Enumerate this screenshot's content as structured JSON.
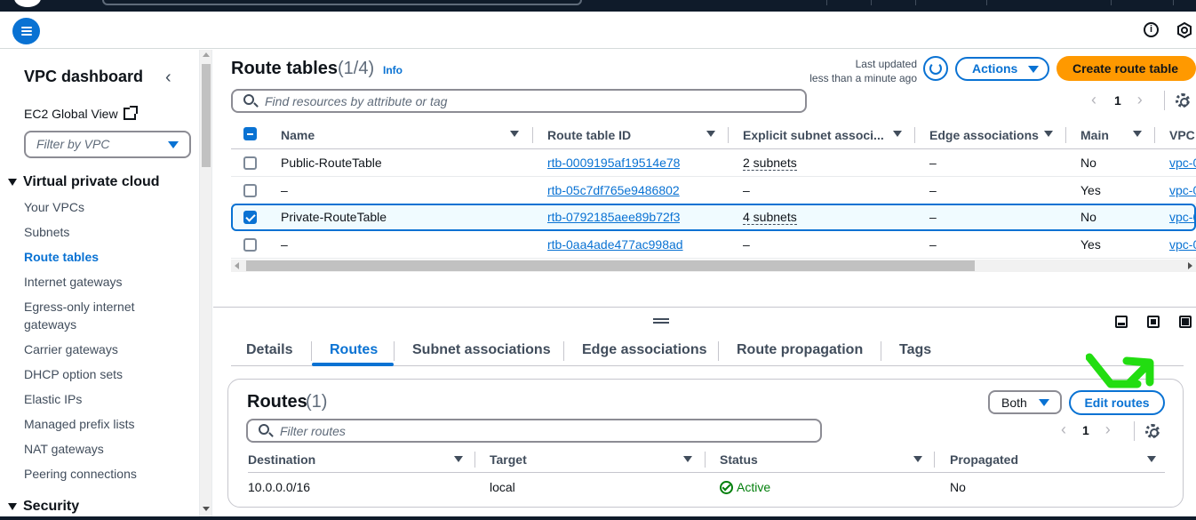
{
  "colors": {
    "accent": "#0972d3",
    "primary_button": "#ff9900",
    "success": "#037f0c",
    "annotation_arrow": "#22dd11"
  },
  "sidebar": {
    "title": "VPC dashboard",
    "ec2_global_view": "EC2 Global View",
    "filter_placeholder": "Filter by VPC",
    "sections": [
      {
        "label": "Virtual private cloud",
        "items": [
          "Your VPCs",
          "Subnets",
          "Route tables",
          "Internet gateways",
          "Egress-only internet gateways",
          "Carrier gateways",
          "DHCP option sets",
          "Elastic IPs",
          "Managed prefix lists",
          "NAT gateways",
          "Peering connections"
        ],
        "active": "Route tables"
      },
      {
        "label": "Security"
      }
    ]
  },
  "header": {
    "title": "Route tables",
    "count": "(1/4)",
    "info": "Info",
    "last_updated_label": "Last updated",
    "last_updated_value": "less than a minute ago",
    "actions_label": "Actions",
    "create_label": "Create route table",
    "search_placeholder": "Find resources by attribute or tag",
    "page": "1"
  },
  "table": {
    "columns": [
      "Name",
      "Route table ID",
      "Explicit subnet associ...",
      "Edge associations",
      "Main",
      "VPC"
    ],
    "rows": [
      {
        "name": "Public-RouteTable",
        "id": "rtb-0009195af19514e78",
        "subnets": "2 subnets",
        "edge": "–",
        "main": "No",
        "vpc": "vpc-0",
        "selected": false
      },
      {
        "name": "–",
        "id": "rtb-05c7df765e9486802",
        "subnets": "–",
        "edge": "–",
        "main": "Yes",
        "vpc": "vpc-0",
        "selected": false
      },
      {
        "name": "Private-RouteTable",
        "id": "rtb-0792185aee89b72f3",
        "subnets": "4 subnets",
        "edge": "–",
        "main": "No",
        "vpc": "vpc-0",
        "selected": true
      },
      {
        "name": "–",
        "id": "rtb-0aa4ade477ac998ad",
        "subnets": "–",
        "edge": "–",
        "main": "Yes",
        "vpc": "vpc-0",
        "selected": false
      }
    ]
  },
  "details": {
    "tabs": [
      "Details",
      "Routes",
      "Subnet associations",
      "Edge associations",
      "Route propagation",
      "Tags"
    ],
    "active_tab": "Routes",
    "routes": {
      "title": "Routes",
      "count": "(1)",
      "filter_value": "Both",
      "edit_label": "Edit routes",
      "filter_placeholder": "Filter routes",
      "page": "1",
      "columns": [
        "Destination",
        "Target",
        "Status",
        "Propagated"
      ],
      "rows": [
        {
          "destination": "10.0.0.0/16",
          "target": "local",
          "status": "Active",
          "propagated": "No"
        }
      ]
    }
  }
}
